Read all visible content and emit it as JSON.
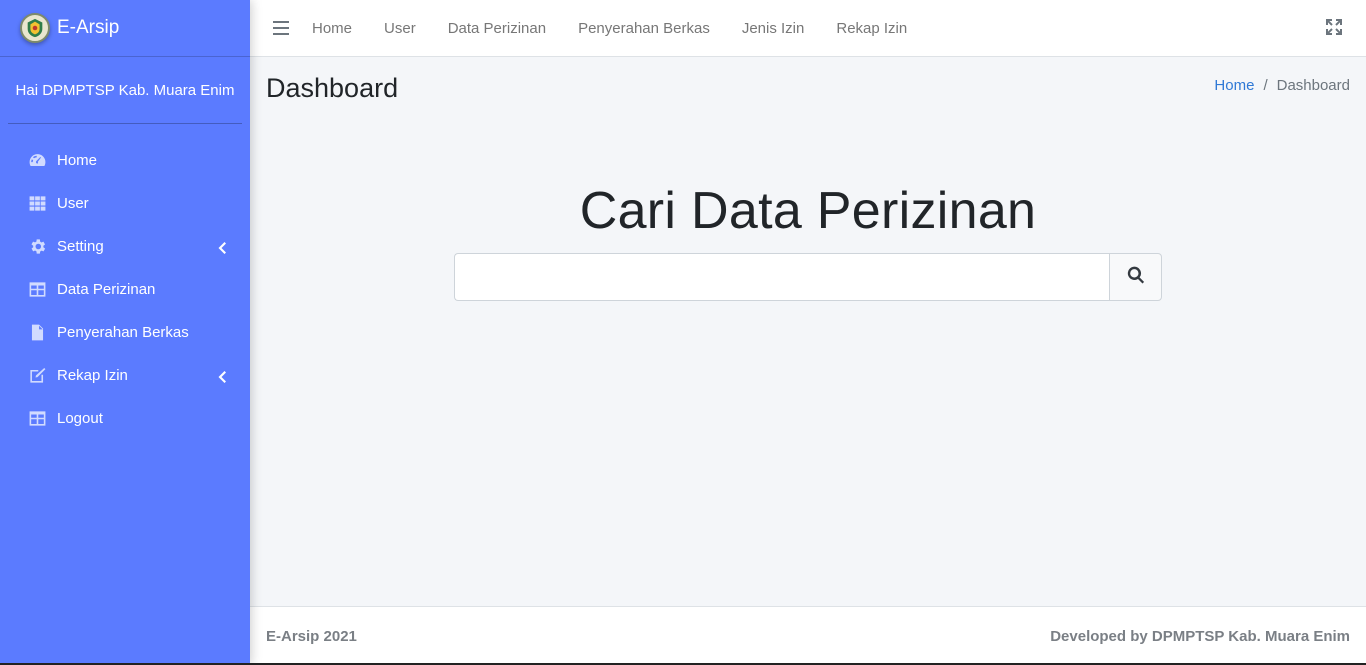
{
  "brand": {
    "name": "E-Arsip",
    "logo_icon": "regency-emblem-icon"
  },
  "user_panel": {
    "greeting": "Hai DPMPTSP Kab. Muara Enim"
  },
  "sidebar": {
    "accent_color": "#5b7bff",
    "items": [
      {
        "label": "Home",
        "icon": "dashboard-gauge-icon",
        "has_submenu": false
      },
      {
        "label": "User",
        "icon": "grid-icon",
        "has_submenu": false
      },
      {
        "label": "Setting",
        "icon": "gear-icon",
        "has_submenu": true
      },
      {
        "label": "Data Perizinan",
        "icon": "table-icon",
        "has_submenu": false
      },
      {
        "label": "Penyerahan Berkas",
        "icon": "file-icon",
        "has_submenu": false
      },
      {
        "label": "Rekap Izin",
        "icon": "edit-icon",
        "has_submenu": true
      },
      {
        "label": "Logout",
        "icon": "table-icon",
        "has_submenu": false
      }
    ]
  },
  "topbar": {
    "menu_icon": "hamburger-icon",
    "links": [
      "Home",
      "User",
      "Data Perizinan",
      "Penyerahan Berkas",
      "Jenis Izin",
      "Rekap Izin"
    ],
    "fullscreen_icon": "expand-icon"
  },
  "page": {
    "title": "Dashboard",
    "breadcrumb": {
      "home": "Home",
      "separator": "/",
      "current": "Dashboard"
    },
    "hero_title": "Cari Data Perizinan",
    "search": {
      "value": "",
      "placeholder": "",
      "button_icon": "search-icon"
    }
  },
  "footer": {
    "left": "E-Arsip 2021",
    "right": "Developed by DPMPTSP Kab. Muara Enim"
  }
}
